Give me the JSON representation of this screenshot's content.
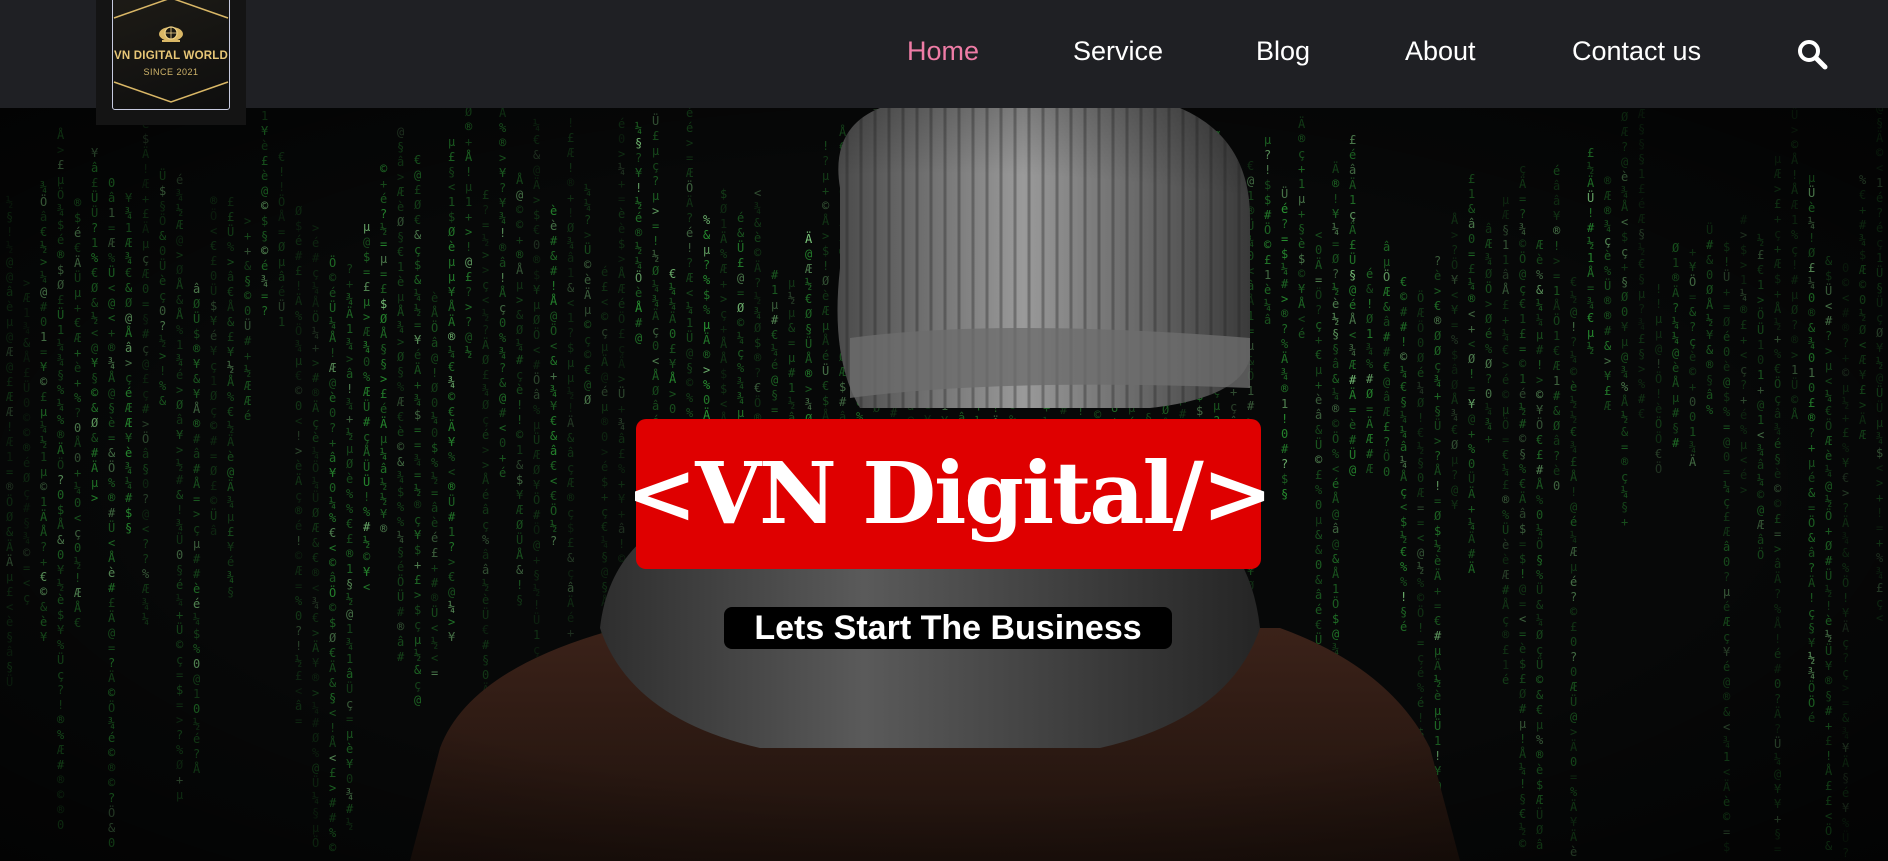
{
  "brand": {
    "name": "VN DIGITAL WORLD",
    "tagline": "SINCE 2021",
    "logo_icon": "globe-emblem-icon",
    "accent_gold": "#e8c777"
  },
  "nav": {
    "items": [
      {
        "label": "Home",
        "active": true
      },
      {
        "label": "Service",
        "active": false
      },
      {
        "label": "Blog",
        "active": false
      },
      {
        "label": "About",
        "active": false
      },
      {
        "label": "Contact us",
        "active": false
      }
    ],
    "search_icon": "search-icon",
    "active_color": "#ef7ca6",
    "bar_color": "#1f2024"
  },
  "hero": {
    "title": "<VN Digital/>",
    "subtitle": "Lets Start The Business",
    "title_bg": "#df0000",
    "subtitle_bg": "#000000",
    "background_image": "hooded-figure-matrix-code"
  }
}
